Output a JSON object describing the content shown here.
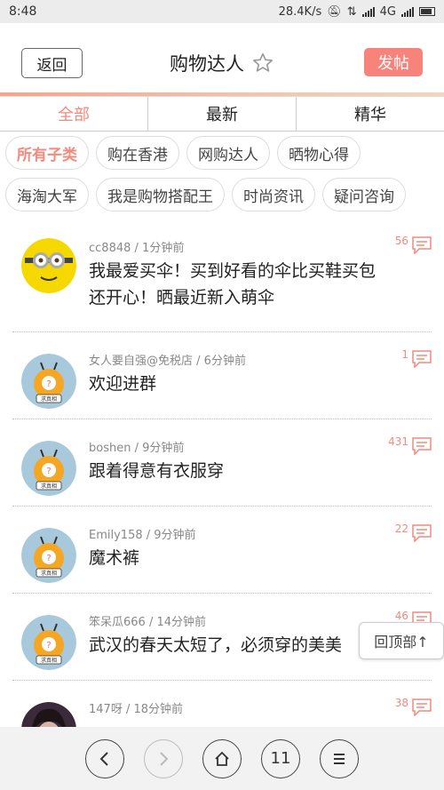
{
  "status": {
    "time": "8:48",
    "speed": "28.4K/s",
    "network": "4G"
  },
  "header": {
    "back_label": "返回",
    "title": "购物达人",
    "post_label": "发帖"
  },
  "tabs": [
    {
      "label": "全部"
    },
    {
      "label": "最新"
    },
    {
      "label": "精华"
    }
  ],
  "chips_row1": [
    {
      "label": "所有子类"
    },
    {
      "label": "购在香港"
    },
    {
      "label": "网购达人"
    },
    {
      "label": "晒物心得"
    }
  ],
  "chips_row2": [
    {
      "label": "海淘大军"
    },
    {
      "label": "我是购物搭配王"
    },
    {
      "label": "时尚资讯"
    },
    {
      "label": "疑问咨询"
    }
  ],
  "posts": [
    {
      "author": "cc8848",
      "time": "1分钟前",
      "count": "56",
      "text_line1": "我最爱买伞！买到好看的伞比买鞋买包",
      "text_line2": "还开心！晒最近新入萌伞",
      "avatar": "minion-avatar"
    },
    {
      "author": "女人要自强@免税店",
      "time": "6分钟前",
      "count": "1",
      "text_line1": "欢迎进群",
      "avatar": "default-avatar"
    },
    {
      "author": "boshen",
      "time": "9分钟前",
      "count": "431",
      "text_line1": "跟着得意有衣服穿",
      "avatar": "default-avatar"
    },
    {
      "author": "Emily158",
      "time": "9分钟前",
      "count": "22",
      "text_line1": "魔术裤",
      "avatar": "default-avatar"
    },
    {
      "author": "笨呆瓜666",
      "time": "14分钟前",
      "count": "46",
      "text_line1": "武汉的春天太短了，必须穿的美美",
      "avatar": "default-avatar"
    },
    {
      "author": "147呀",
      "time": "18分钟前",
      "count": "38",
      "text_line1": "",
      "avatar": "photo-avatar"
    }
  ],
  "default_avatar_text": "求真相",
  "back_to_top": "回顶部↑",
  "bottom_nav": {
    "tabs_count": "11"
  },
  "colors": {
    "accent": "#f48a7d",
    "post_button": "#f7837b"
  }
}
